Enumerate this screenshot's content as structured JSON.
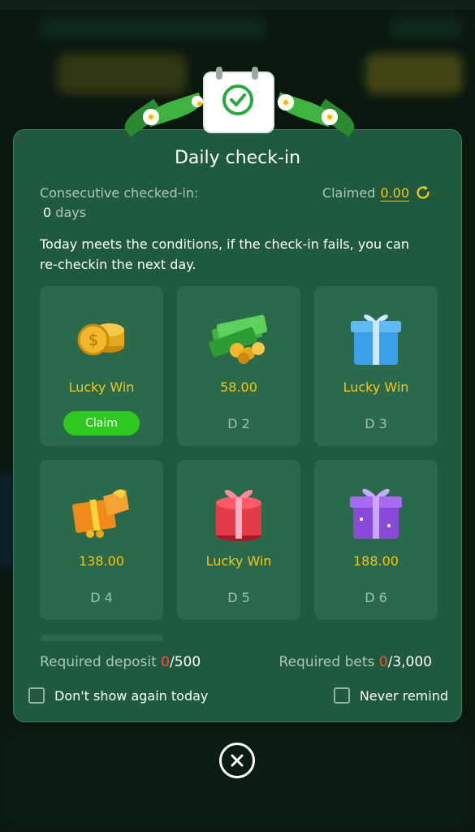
{
  "dialog": {
    "title": "Daily check-in",
    "consecutive_label": "Consecutive checked-in:",
    "consecutive_count": "0",
    "consecutive_unit": "days",
    "claimed_label": "Claimed",
    "claimed_amount": "0.00",
    "notice": "Today meets the conditions, if the check-in fails, you can re-checkin the next day.",
    "cards": [
      {
        "reward": "Lucky Win",
        "action": "Claim",
        "icon": "gold-coins-icon"
      },
      {
        "reward": "58.00",
        "day": "D 2",
        "icon": "cash-stack-icon"
      },
      {
        "reward": "Lucky Win",
        "day": "D 3",
        "icon": "blue-gift-icon"
      },
      {
        "reward": "138.00",
        "day": "D 4",
        "icon": "orange-gift-icon"
      },
      {
        "reward": "Lucky Win",
        "day": "D 5",
        "icon": "red-gift-icon"
      },
      {
        "reward": "188.00",
        "day": "D 6",
        "icon": "purple-gift-icon"
      }
    ],
    "required_deposit_label": "Required deposit",
    "required_deposit_current": "0",
    "required_deposit_total": "/500",
    "required_bets_label": "Required bets",
    "required_bets_current": "0",
    "required_bets_total": "/3,000",
    "dont_show_today": "Don't show again today",
    "never_remind": "Never remind"
  },
  "colors": {
    "modal_bg": "#1f5a3f",
    "card_bg": "#2a6a4a",
    "gold": "#f5c518",
    "claim_green": "#2ec81f",
    "required_current": "#ff4d3d"
  }
}
